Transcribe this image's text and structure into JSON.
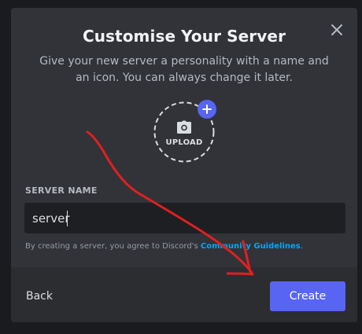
{
  "modal": {
    "title": "Customise Your Server",
    "subtitle": "Give your new server a personality with a name and an icon. You can always change it later.",
    "close_icon": "close-icon"
  },
  "upload": {
    "label": "UPLOAD",
    "icon": "camera-icon",
    "badge_icon": "plus-icon"
  },
  "form": {
    "server_name_label": "SERVER NAME",
    "server_name_value": "server",
    "terms_prefix": "By creating a server, you agree to Discord's ",
    "terms_link": "Community Guidelines",
    "terms_suffix": "."
  },
  "footer": {
    "back_label": "Back",
    "create_label": "Create"
  },
  "colors": {
    "accent": "#5865f2",
    "link": "#00a8fc",
    "annotation_arrow": "#e02020"
  }
}
